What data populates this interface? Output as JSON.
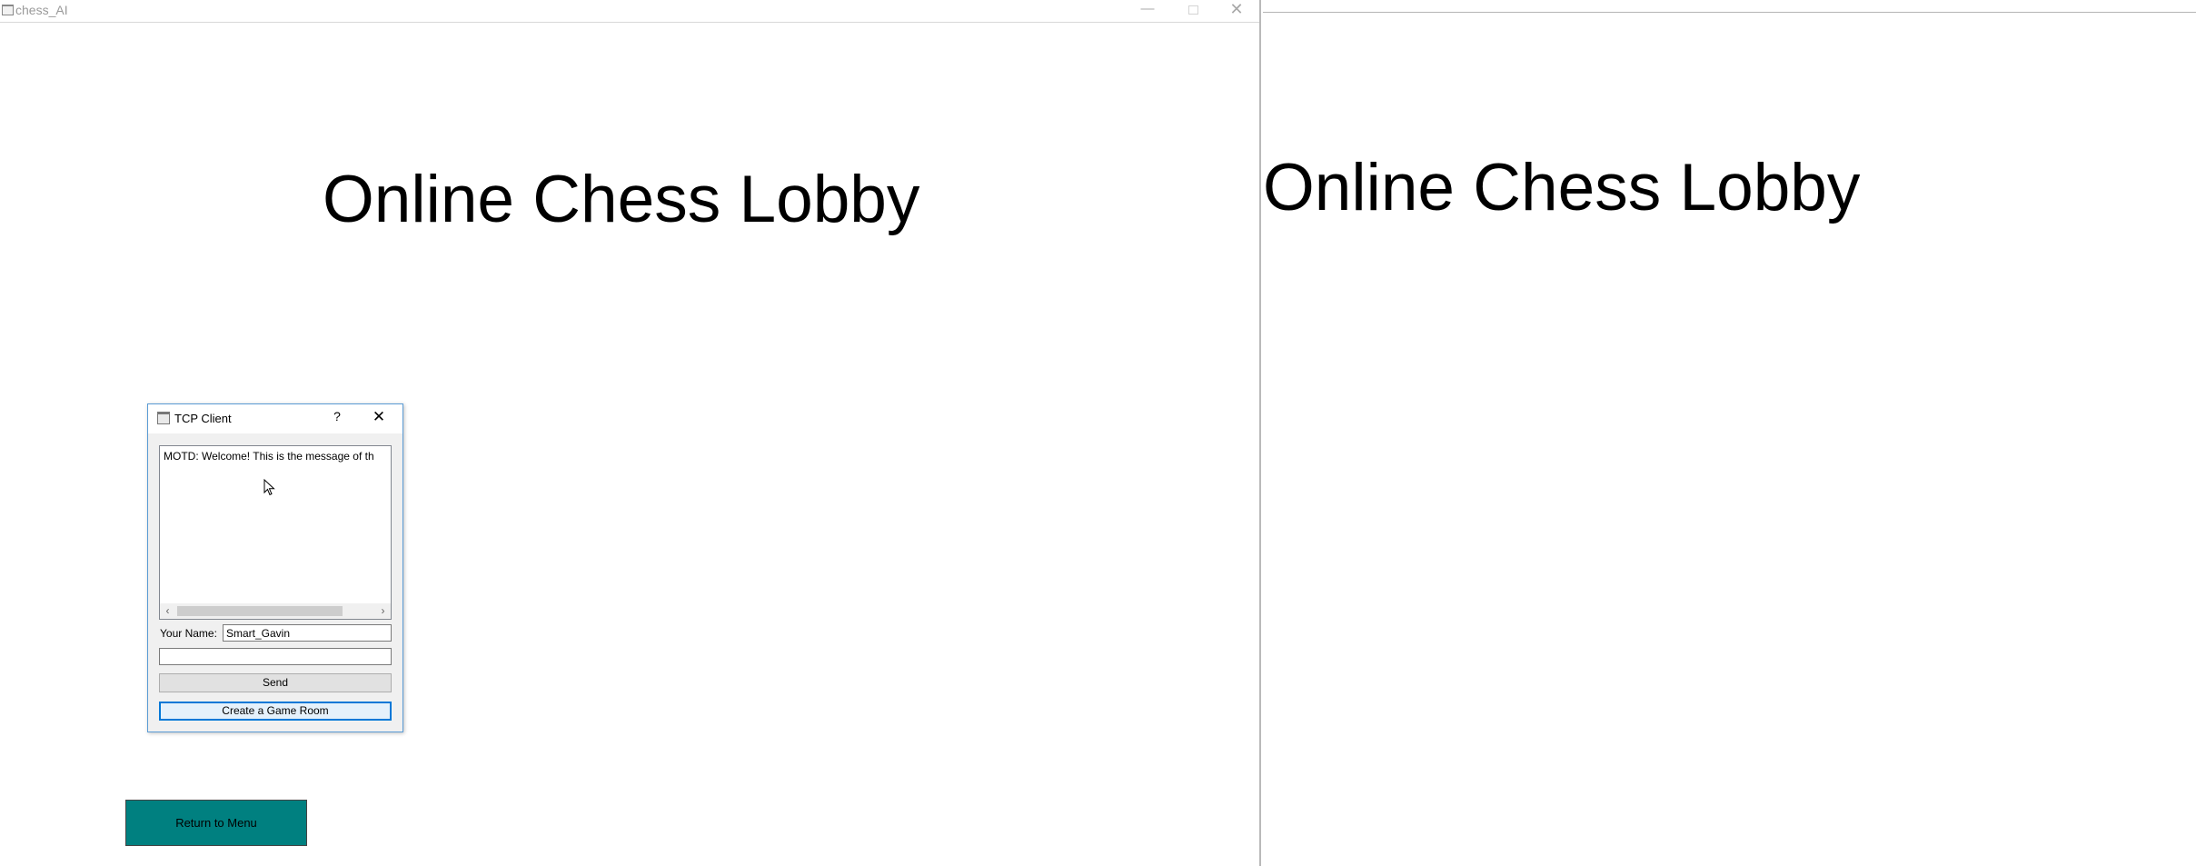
{
  "left_window": {
    "title": "chess_AI",
    "controls": {
      "minimize": "—",
      "close": "✕"
    },
    "lobby_title": "Online Chess Lobby",
    "return_button": "Return to Menu"
  },
  "right_window": {
    "lobby_title": "Online Chess Lobby"
  },
  "tcp_dialog": {
    "title": "TCP Client",
    "help": "?",
    "close": "✕",
    "log_line": "MOTD: Welcome! This is the message of th",
    "scroll_left": "‹",
    "scroll_right": "›",
    "name_label": "Your Name:",
    "name_value": "Smart_Gavin",
    "message_value": "",
    "send_label": "Send",
    "create_room_label": "Create a Game Room"
  },
  "icons": [
    "app-icon",
    "minimize-icon",
    "maximize-icon",
    "close-icon",
    "help-icon",
    "scroll-left-icon",
    "scroll-right-icon",
    "mouse-cursor-icon"
  ],
  "colors": {
    "return_button_bg": "#008080",
    "dialog_border": "#5a9bd5",
    "focused_button_border": "#0078d7"
  }
}
